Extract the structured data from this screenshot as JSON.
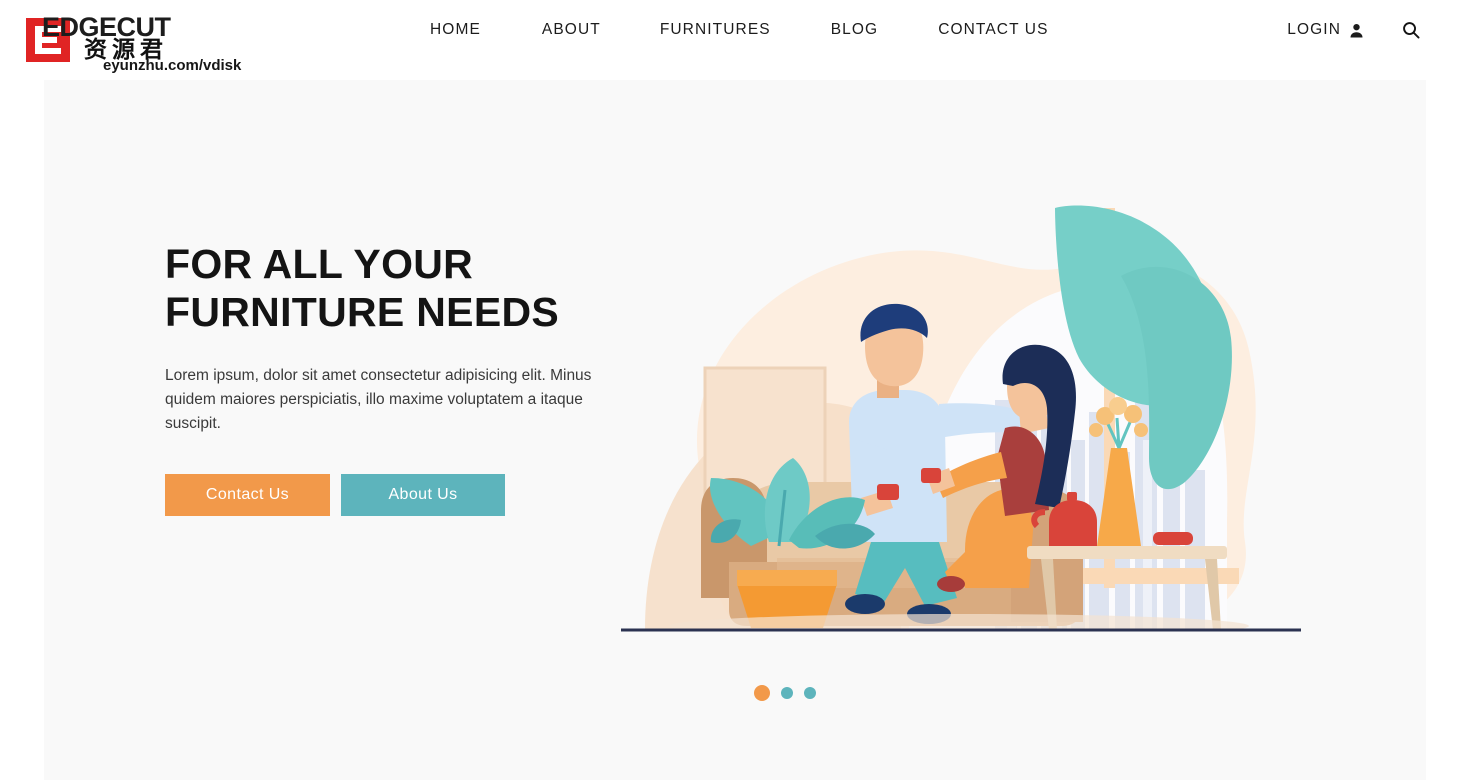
{
  "brand": {
    "logo_letter": "E",
    "wordmark": "EDGECUT",
    "watermark_cn": "资源君",
    "watermark_url": "eyunzhu.com/vdisk",
    "logo_color": "#e02424"
  },
  "nav": {
    "items": [
      {
        "label": "HOME"
      },
      {
        "label": "ABOUT"
      },
      {
        "label": "FURNITURES"
      },
      {
        "label": "BLOG"
      },
      {
        "label": "CONTACT US"
      }
    ],
    "login_label": "LOGIN",
    "user_icon": "user-icon",
    "search_icon": "search-icon"
  },
  "hero": {
    "title": "FOR ALL YOUR\nFURNITURE NEEDS",
    "paragraph": "Lorem ipsum, dolor sit amet consectetur adipisicing elit. Minus quidem maiores perspiciatis, illo maxime voluptatem a itaque suscipit.",
    "primary_button": "Contact Us",
    "secondary_button": "About Us",
    "primary_color": "#f2994a",
    "secondary_color": "#5db4bc",
    "background_color": "#f9f9f9",
    "illustration": "living-room-couple-on-sofa"
  },
  "carousel": {
    "slides": 3,
    "active_index": 0,
    "active_color": "#f2994a",
    "inactive_color": "#5db4bc"
  }
}
